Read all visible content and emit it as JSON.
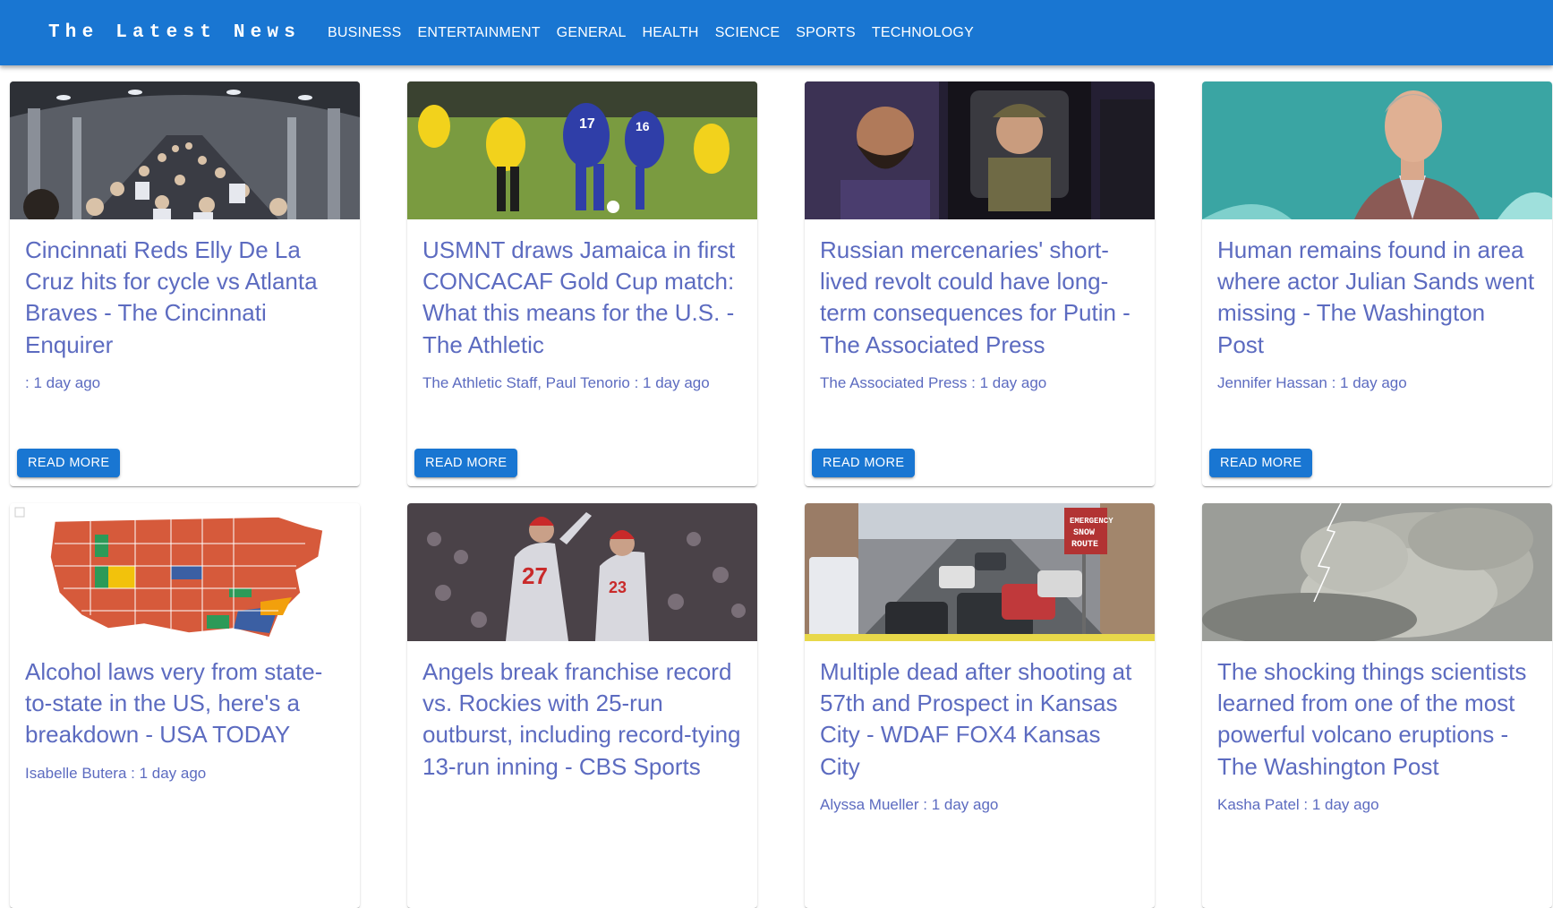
{
  "header": {
    "brand": "The Latest News",
    "nav": [
      "BUSINESS",
      "ENTERTAINMENT",
      "GENERAL",
      "HEALTH",
      "SCIENCE",
      "SPORTS",
      "TECHNOLOGY"
    ]
  },
  "button_label": "READ MORE",
  "articles": [
    {
      "title": "Cincinnati Reds Elly De La Cruz hits for cycle vs Atlanta Braves - The Cincinnati Enquirer",
      "meta": ": 1 day ago",
      "image": "crowd-photo"
    },
    {
      "title": "USMNT draws Jamaica in first CONCACAF Gold Cup match: What this means for the U.S. - The Athletic",
      "meta": "The Athletic Staff, Paul Tenorio : 1 day ago",
      "image": "soccer-photo"
    },
    {
      "title": "Russian mercenaries' short-lived revolt could have long-term consequences for Putin - The Associated Press",
      "meta": "The Associated Press : 1 day ago",
      "image": "vehicle-photo"
    },
    {
      "title": "Human remains found in area where actor Julian Sands went missing - The Washington Post",
      "meta": "Jennifer Hassan : 1 day ago",
      "image": "portrait-photo"
    },
    {
      "title": "Alcohol laws very from state-to-state in the US, here's a breakdown - USA TODAY",
      "meta": "Isabelle Butera : 1 day ago",
      "image": "us-map"
    },
    {
      "title": "Angels break franchise record vs. Rockies with 25-run outburst, including record-tying 13-run inning - CBS Sports",
      "meta": "",
      "image": "baseball-photo"
    },
    {
      "title": "Multiple dead after shooting at 57th and Prospect in Kansas City - WDAF FOX4 Kansas City",
      "meta": "Alyssa Mueller : 1 day ago",
      "image": "street-photo"
    },
    {
      "title": "The shocking things scientists learned from one of the most powerful volcano eruptions - The Washington Post",
      "meta": "Kasha Patel : 1 day ago",
      "image": "volcano-photo"
    }
  ],
  "colors": {
    "appbar": "#1976d2",
    "link": "#5c6bc0",
    "button": "#1976d2"
  }
}
